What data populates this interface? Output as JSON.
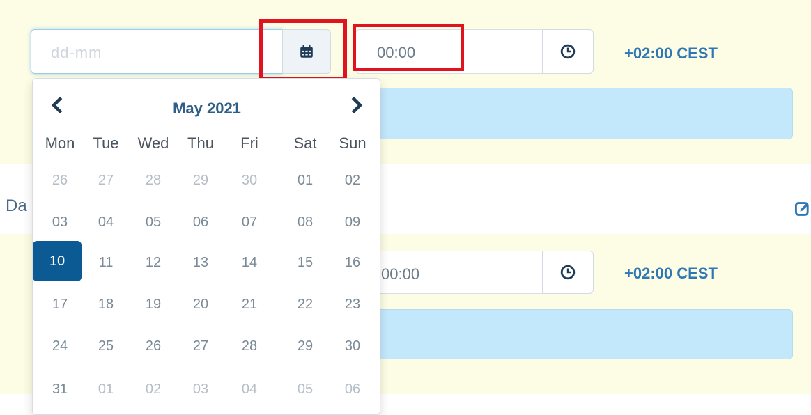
{
  "top_row": {
    "date_placeholder": "dd-mm",
    "time_value": "00:00",
    "timezone": "+02:00 CEST"
  },
  "section": {
    "label": "Da"
  },
  "bottom_row": {
    "time_value": "00:00",
    "timezone": "+02:00 CEST"
  },
  "calendar": {
    "title": "May 2021",
    "weekdays": [
      "Mon",
      "Tue",
      "Wed",
      "Thu",
      "Fri",
      "Sat",
      "Sun"
    ],
    "weeks": [
      [
        "26",
        "27",
        "28",
        "29",
        "30",
        "01",
        "02"
      ],
      [
        "03",
        "04",
        "05",
        "06",
        "07",
        "08",
        "09"
      ],
      [
        "10",
        "11",
        "12",
        "13",
        "14",
        "15",
        "16"
      ],
      [
        "17",
        "18",
        "19",
        "20",
        "21",
        "22",
        "23"
      ],
      [
        "24",
        "25",
        "26",
        "27",
        "28",
        "29",
        "30"
      ],
      [
        "31",
        "01",
        "02",
        "03",
        "04",
        "05",
        "06"
      ]
    ],
    "selected_day": "10"
  },
  "colors": {
    "accent": "#0c5a93",
    "highlight": "#e0141e",
    "timezone_text": "#2d77b4"
  },
  "icons": {
    "date_addon": "calendar-icon",
    "time_addon": "clock-icon",
    "prev": "chevron-left-icon",
    "next": "chevron-right-icon",
    "edit": "edit-icon"
  }
}
